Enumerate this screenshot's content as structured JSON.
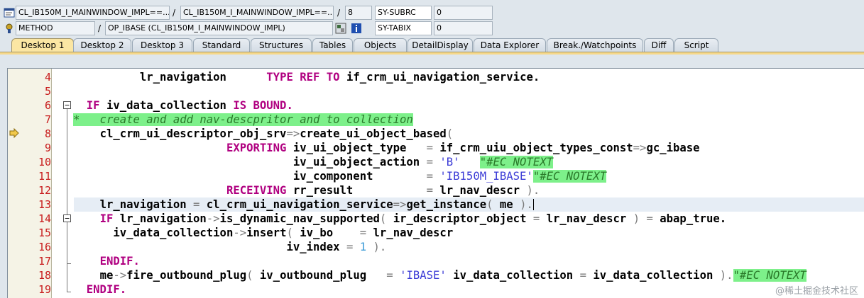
{
  "info": {
    "program": "CL_IB150M_I_MAINWINDOW_IMPL==...",
    "include": "CL_IB150M_I_MAINWINDOW_IMPL==...",
    "line_no": "8",
    "var1_name": "SY-SUBRC",
    "var1_value": "0",
    "event_type": "METHOD",
    "event_name": "OP_IBASE (CL_IB150M_I_MAINWINDOW_IMPL)",
    "var2_name": "SY-TABIX",
    "var2_value": "0",
    "slash": "/"
  },
  "tabs": [
    {
      "label": "Desktop 1"
    },
    {
      "label": "Desktop 2"
    },
    {
      "label": "Desktop 3"
    },
    {
      "label": "Standard"
    },
    {
      "label": "Structures"
    },
    {
      "label": "Tables"
    },
    {
      "label": "Objects"
    },
    {
      "label": "DetailDisplay"
    },
    {
      "label": "Data Explorer"
    },
    {
      "label": "Break./Watchpoints"
    },
    {
      "label": "Diff"
    },
    {
      "label": "Script"
    }
  ],
  "active_tab": "Desktop 1",
  "editor": {
    "lines": [
      {
        "no": "4"
      },
      {
        "no": "5"
      },
      {
        "no": "6"
      },
      {
        "no": "7"
      },
      {
        "no": "8"
      },
      {
        "no": "9"
      },
      {
        "no": "10"
      },
      {
        "no": "11"
      },
      {
        "no": "12"
      },
      {
        "no": "13"
      },
      {
        "no": "14"
      },
      {
        "no": "15"
      },
      {
        "no": "16"
      },
      {
        "no": "17"
      },
      {
        "no": "18"
      },
      {
        "no": "19"
      }
    ],
    "tokens": {
      "l4_a": "lr_navigation",
      "l4_kw": "TYPE REF TO",
      "l4_b": "if_crm_ui_navigation_service.",
      "l6_kw1": "IF",
      "l6_a": "iv_data_collection",
      "l6_kw2": "IS BOUND.",
      "l7_cmt": "*   create and add nav-descpritor and to collection",
      "l8_a": "cl_crm_ui_descriptor_obj_srv",
      "l8_op": "=>",
      "l8_b": "create_ui_object_based",
      "l8_paren": "(",
      "l9_kw": "EXPORTING",
      "l9_a": "iv_ui_object_type",
      "l9_eq": "=",
      "l9_b": "if_crm_uiu_object_types_const",
      "l9_op": "=>",
      "l9_c": "gc_ibase",
      "l10_a": "iv_ui_object_action",
      "l10_eq": "=",
      "l10_str": "'B'",
      "l10_pragma": "\"#EC NOTEXT",
      "l11_a": "iv_component",
      "l11_eq": "=",
      "l11_str": "'IB150M_IBASE'",
      "l11_pragma": "\"#EC NOTEXT",
      "l12_kw": "RECEIVING",
      "l12_a": "rr_result",
      "l12_eq": "=",
      "l12_b": "lr_nav_descr",
      "l12_end": ").",
      "l13_a": "lr_navigation",
      "l13_eq": "=",
      "l13_b": "cl_crm_ui_navigation_service",
      "l13_op": "=>",
      "l13_c": "get_instance",
      "l13_p1": "(",
      "l13_d": "me",
      "l13_p2": ").",
      "l14_kw": "IF",
      "l14_a": "lr_navigation",
      "l14_op": "->",
      "l14_b": "is_dynamic_nav_supported",
      "l14_p1": "(",
      "l14_c": "ir_descriptor_object",
      "l14_eq": "=",
      "l14_d": "lr_nav_descr",
      "l14_p2": ")",
      "l14_eq2": "=",
      "l14_e": "abap_true.",
      "l15_a": "iv_data_collection",
      "l15_op": "->",
      "l15_b": "insert",
      "l15_p1": "(",
      "l15_c": "iv_bo",
      "l15_eq": "=",
      "l15_d": "lr_nav_descr",
      "l16_a": "iv_index",
      "l16_eq": "=",
      "l16_num": "1",
      "l16_end": ").",
      "l17_kw": "ENDIF.",
      "l18_a": "me",
      "l18_op": "->",
      "l18_b": "fire_outbound_plug",
      "l18_p1": "(",
      "l18_c": "iv_outbound_plug",
      "l18_eq": "=",
      "l18_str": "'IBASE'",
      "l18_d": "iv_data_collection",
      "l18_eq2": "=",
      "l18_e": "iv_data_collection",
      "l18_end": ").",
      "l18_pragma": "\"#EC NOTEXT",
      "l19_kw": "ENDIF."
    }
  },
  "watermark": "@稀土掘金技术社区",
  "colors": {
    "keyword": "#b00080",
    "line_number": "#c81d1d",
    "comment_bg": "#7df08a",
    "string": "#3b3bd6",
    "active_tab": "#fbe6a3"
  }
}
